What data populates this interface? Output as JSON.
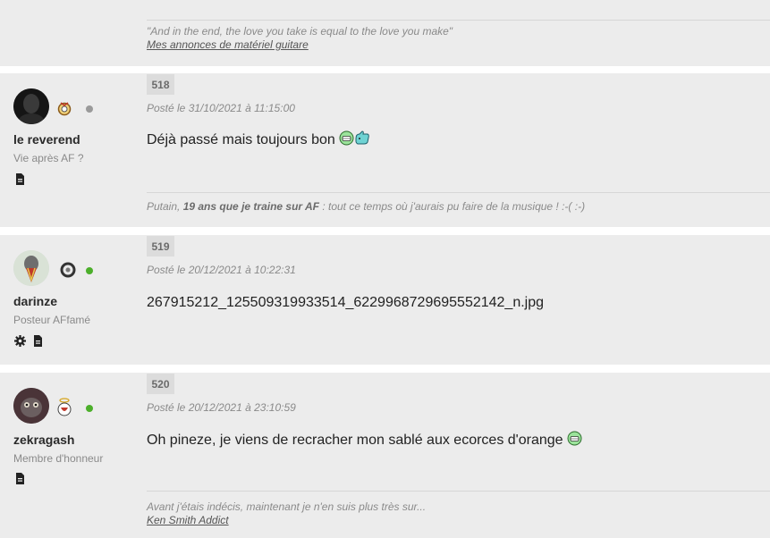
{
  "top_signature": {
    "quote": "\"And in the end, the love you take is equal to the love you make\"",
    "link": "Mes annonces de matériel guitare"
  },
  "posts": [
    {
      "number": "518",
      "date": "Posté le 31/10/2021 à 11:15:00",
      "username": "le reverend",
      "user_title": "Vie après AF ?",
      "status_color": "#9a9a9a",
      "body": "Déjà passé mais toujours bon",
      "signature_prefix": "Putain, ",
      "signature_bold": "19 ans que je traine sur AF",
      "signature_suffix": " : tout ce temps où j'aurais pu faire de la musique ! :-( :-)"
    },
    {
      "number": "519",
      "date": "Posté le 20/12/2021 à 10:22:31",
      "username": "darinze",
      "user_title": "Posteur AFfamé",
      "status_color": "#4caf2b",
      "body": "267915212_125509319933514_6229968729695552142_n.jpg"
    },
    {
      "number": "520",
      "date": "Posté le 20/12/2021 à 23:10:59",
      "username": "zekragash",
      "user_title": "Membre d'honneur",
      "status_color": "#4caf2b",
      "body": "Oh pineze, je viens de recracher mon sablé aux ecorces d'orange",
      "signature_line1": "Avant j'étais indécis, maintenant je n'en suis plus très sur...",
      "signature_link": "Ken Smith Addict"
    }
  ],
  "icons": {
    "profile": "document-icon",
    "settings": "gear-icon",
    "laugh": "laughing-smiley-icon",
    "thumb": "thumbs-up-smiley-icon"
  }
}
